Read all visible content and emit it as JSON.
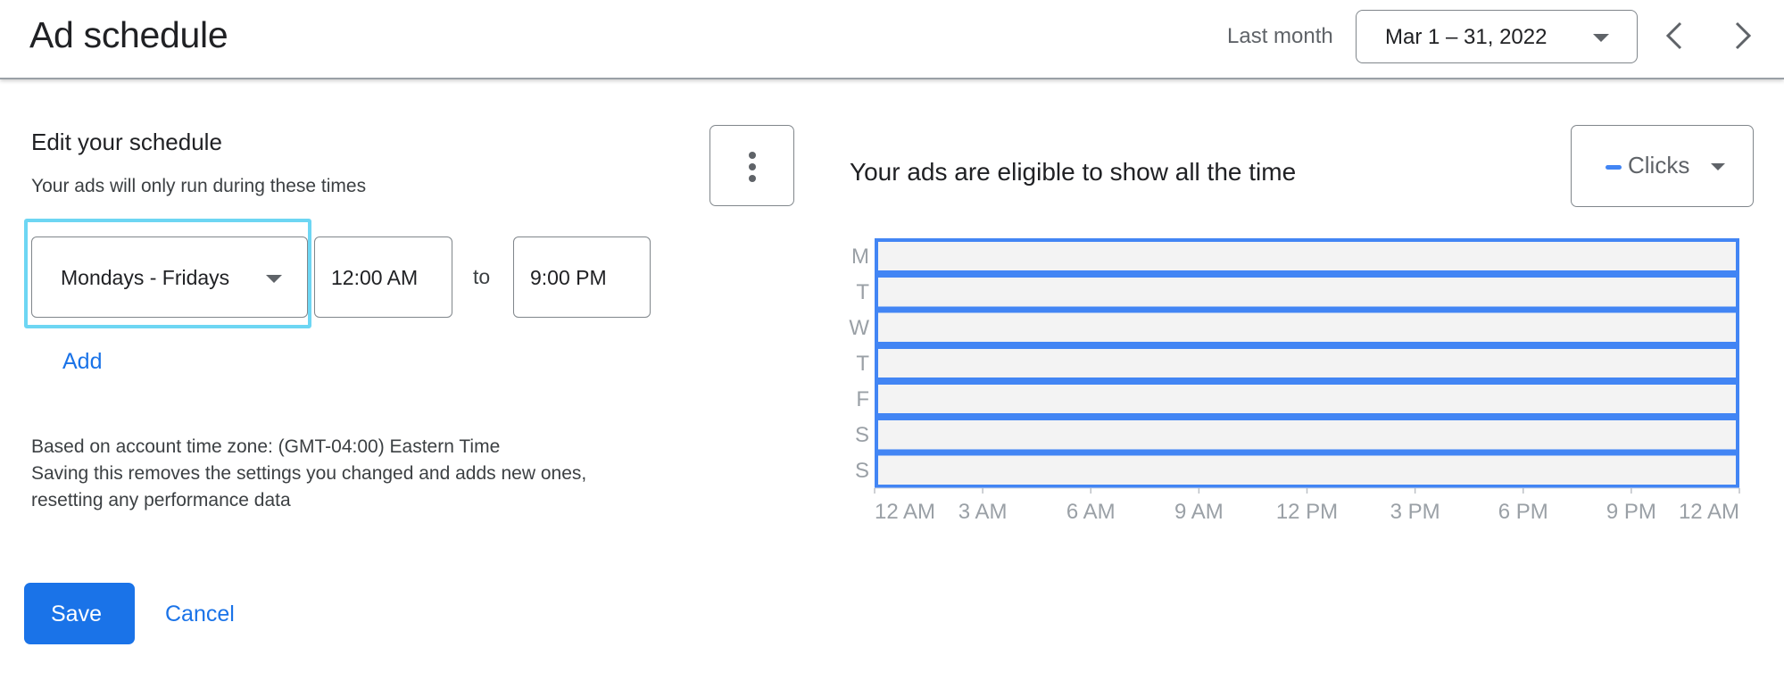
{
  "header": {
    "title": "Ad schedule",
    "date_range_label": "Last month",
    "date_range_value": "Mar 1 – 31, 2022",
    "prev_label": "Previous period",
    "next_label": "Next period"
  },
  "editor": {
    "heading": "Edit your schedule",
    "subheading": "Your ads will only run during these times",
    "rows": [
      {
        "days": "Mondays - Fridays",
        "start": "12:00 AM",
        "separator": "to",
        "end": "9:00 PM"
      }
    ],
    "add_label": "Add",
    "info_lines": [
      "Based on account time zone: (GMT-04:00) Eastern Time",
      "Saving this removes the settings you changed and adds new ones,",
      "resetting any performance data"
    ],
    "save_label": "Save",
    "cancel_label": "Cancel"
  },
  "chart_panel": {
    "title": "Your ads are eligible to show all the time",
    "metric": "Clicks",
    "colors": {
      "accent": "#4285f4",
      "cell_fill": "#f3f3f3",
      "label": "#9aa0a6"
    }
  },
  "chart_data": {
    "type": "heatmap",
    "title": "Your ads are eligible to show all the time",
    "metric": "Clicks",
    "y_labels": [
      "M",
      "T",
      "W",
      "T",
      "F",
      "S",
      "S"
    ],
    "x_ticks": [
      "12 AM",
      "3 AM",
      "6 AM",
      "9 AM",
      "12 PM",
      "3 PM",
      "6 PM",
      "9 PM",
      "12 AM"
    ],
    "x_range_hours": [
      0,
      24
    ],
    "eligible_windows": [
      {
        "day": "M",
        "start_hour": 0,
        "end_hour": 24
      },
      {
        "day": "T",
        "start_hour": 0,
        "end_hour": 24
      },
      {
        "day": "W",
        "start_hour": 0,
        "end_hour": 24
      },
      {
        "day": "T",
        "start_hour": 0,
        "end_hour": 24
      },
      {
        "day": "F",
        "start_hour": 0,
        "end_hour": 24
      },
      {
        "day": "S",
        "start_hour": 0,
        "end_hour": 24
      },
      {
        "day": "S",
        "start_hour": 0,
        "end_hour": 24
      }
    ],
    "row_groups": [
      [
        0
      ],
      [
        1,
        2
      ],
      [
        3
      ],
      [
        4
      ],
      [
        5,
        6
      ]
    ]
  }
}
